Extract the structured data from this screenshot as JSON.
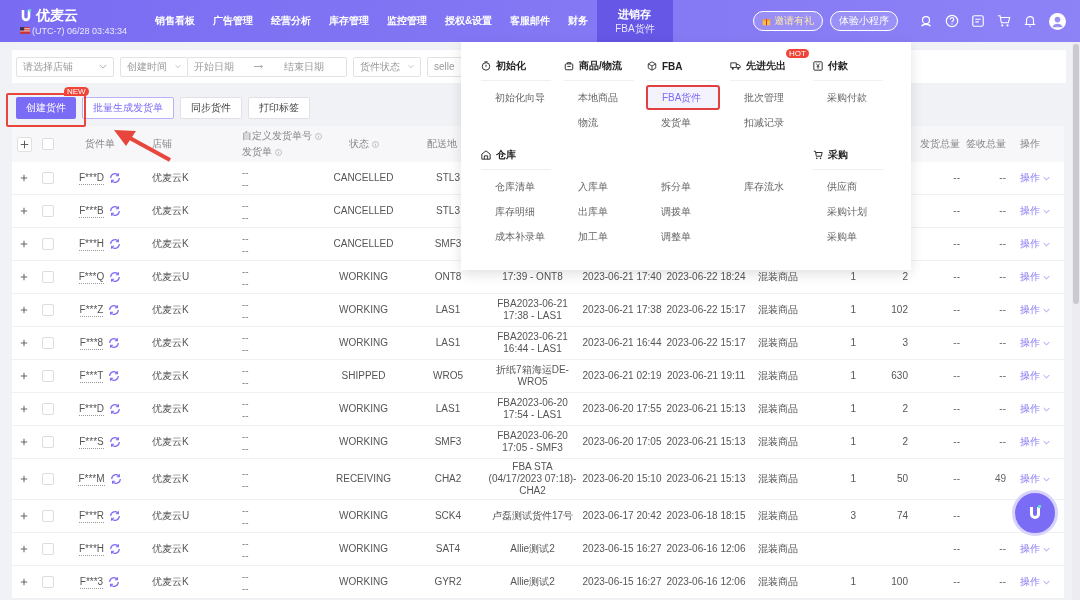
{
  "header": {
    "logo": "优麦云",
    "timezone": "(UTC-7) 06/28 03:43:34",
    "nav": [
      {
        "label": "销售看板",
        "selected": false
      },
      {
        "label": "广告管理",
        "selected": false
      },
      {
        "label": "经营分析",
        "selected": false
      },
      {
        "label": "库存管理",
        "selected": false
      },
      {
        "label": "监控管理",
        "selected": false
      },
      {
        "label": "授权&设置",
        "selected": false
      },
      {
        "label": "客服邮件",
        "selected": false
      },
      {
        "label": "财务",
        "selected": false
      },
      {
        "label": "进销存",
        "sub": "FBA货件",
        "selected": true
      }
    ],
    "actions": [
      "邀请有礼",
      "体验小程序"
    ]
  },
  "filters": [
    {
      "kind": "select",
      "placeholder": "请选择店铺"
    },
    {
      "kind": "select",
      "placeholder": "创建时间"
    },
    {
      "kind": "range",
      "placeholder": "开始日期",
      "placeholder_2": "结束日期"
    },
    {
      "kind": "select",
      "placeholder": "货件状态"
    },
    {
      "kind": "text",
      "placeholder": "selle"
    }
  ],
  "toolbar": [
    {
      "label": "创建货件",
      "kind": "primary",
      "badge": "NEW"
    },
    {
      "label": "批量生成发货单",
      "kind": "outline"
    },
    {
      "label": "同步货件",
      "kind": "plain"
    },
    {
      "label": "打印标签",
      "kind": "plain"
    }
  ],
  "table": {
    "all_checked": false,
    "columns": [
      {},
      {},
      {
        "labels": [
          {
            "text": "货件单",
            "info": false
          }
        ]
      },
      {
        "labels": [
          {
            "text": "店铺",
            "info": false
          }
        ]
      },
      {
        "labels": [
          {
            "text": "自定义发货单号",
            "info": true
          },
          {
            "text": "发货单",
            "info": true
          }
        ]
      },
      {
        "labels": [
          {
            "text": "状态",
            "info": true
          }
        ]
      },
      {
        "labels": [
          {
            "text": "配送地",
            "info": false
          }
        ]
      },
      {},
      {},
      {},
      {},
      {},
      {},
      {
        "labels": [
          {
            "text": "发货总量",
            "info": false
          }
        ]
      },
      {
        "labels": [
          {
            "text": "签收总量",
            "info": false
          }
        ]
      },
      {
        "labels": [
          {
            "text": "操作",
            "info": false
          }
        ]
      }
    ],
    "rows": [
      {
        "checked": false,
        "shipment": "F***D",
        "shop": "优麦云K",
        "custom": [
          "--",
          "--"
        ],
        "status": "CANCELLED",
        "address": "STL3",
        "shipped": "--",
        "received": "--",
        "action": "操作"
      },
      {
        "checked": false,
        "shipment": "F***B",
        "shop": "优麦云K",
        "custom": [
          "--",
          "--"
        ],
        "status": "CANCELLED",
        "address": "STL3",
        "shipped": "--",
        "received": "--",
        "action": "操作"
      },
      {
        "checked": false,
        "shipment": "F***H",
        "shop": "优麦云K",
        "custom": [
          "--",
          "--"
        ],
        "status": "CANCELLED",
        "address": "SMF3",
        "shipped": "--",
        "received": "--",
        "action": "操作"
      },
      {
        "checked": false,
        "shipment": "F***Q",
        "shop": "优麦云U",
        "custom": [
          "--",
          "--"
        ],
        "status": "WORKING",
        "address": "ONT8",
        "name": "17:39 - ONT8",
        "created": "2023-06-21 17:40",
        "updated": "2023-06-22 18:24",
        "mix": "混装商品",
        "col_a": "1",
        "col_b": "2",
        "shipped": "--",
        "received": "--",
        "action": "操作"
      },
      {
        "checked": false,
        "shipment": "F***Z",
        "shop": "优麦云K",
        "custom": [
          "--",
          "--"
        ],
        "status": "WORKING",
        "address": "LAS1",
        "name": "FBA2023-06-21 17:38 - LAS1",
        "created": "2023-06-21 17:38",
        "updated": "2023-06-22 15:17",
        "mix": "混装商品",
        "col_a": "1",
        "col_b": "102",
        "shipped": "--",
        "received": "--",
        "action": "操作"
      },
      {
        "checked": false,
        "shipment": "F***8",
        "shop": "优麦云K",
        "custom": [
          "--",
          "--"
        ],
        "status": "WORKING",
        "address": "LAS1",
        "name": "FBA2023-06-21 16:44 - LAS1",
        "created": "2023-06-21 16:44",
        "updated": "2023-06-22 15:17",
        "mix": "混装商品",
        "col_a": "1",
        "col_b": "3",
        "shipped": "--",
        "received": "--",
        "action": "操作"
      },
      {
        "checked": false,
        "shipment": "F***T",
        "shop": "优麦云K",
        "custom": [
          "--",
          "--"
        ],
        "status": "SHIPPED",
        "address": "WRO5",
        "name": "折纸7箱海运DE-WRO5",
        "created": "2023-06-21 02:19",
        "updated": "2023-06-21 19:11",
        "mix": "混装商品",
        "col_a": "1",
        "col_b": "630",
        "shipped": "--",
        "received": "--",
        "action": "操作"
      },
      {
        "checked": false,
        "shipment": "F***D",
        "shop": "优麦云K",
        "custom": [
          "--",
          "--"
        ],
        "status": "WORKING",
        "address": "LAS1",
        "name": "FBA2023-06-20 17:54 - LAS1",
        "created": "2023-06-20 17:55",
        "updated": "2023-06-21 15:13",
        "mix": "混装商品",
        "col_a": "1",
        "col_b": "2",
        "shipped": "--",
        "received": "--",
        "action": "操作"
      },
      {
        "checked": false,
        "shipment": "F***S",
        "shop": "优麦云K",
        "custom": [
          "--",
          "--"
        ],
        "status": "WORKING",
        "address": "SMF3",
        "name": "FBA2023-06-20 17:05 - SMF3",
        "created": "2023-06-20 17:05",
        "updated": "2023-06-21 15:13",
        "mix": "混装商品",
        "col_a": "1",
        "col_b": "2",
        "shipped": "--",
        "received": "--",
        "action": "操作"
      },
      {
        "checked": false,
        "shipment": "F***M",
        "shop": "优麦云K",
        "custom": [
          "--",
          "--"
        ],
        "status": "RECEIVING",
        "address": "CHA2",
        "name": "FBA STA (04/17/2023 07:18)-CHA2",
        "created": "2023-06-20 15:10",
        "updated": "2023-06-21 15:13",
        "mix": "混装商品",
        "col_a": "1",
        "col_b": "50",
        "shipped": "--",
        "received": "49",
        "action": "操作"
      },
      {
        "checked": false,
        "shipment": "F***R",
        "shop": "优麦云U",
        "custom": [
          "--",
          "--"
        ],
        "status": "WORKING",
        "address": "SCK4",
        "name": "卢磊测试货件17号",
        "created": "2023-06-17 20:42",
        "updated": "2023-06-18 18:15",
        "mix": "混装商品",
        "col_a": "3",
        "col_b": "74",
        "shipped": "--"
      },
      {
        "checked": false,
        "shipment": "F***H",
        "shop": "优麦云K",
        "custom": [
          "--",
          "--"
        ],
        "status": "WORKING",
        "address": "SAT4",
        "name": "Allie测试2",
        "created": "2023-06-15 16:27",
        "updated": "2023-06-16 12:06",
        "mix": "混装商品",
        "shipped": "--",
        "received": "--",
        "action": "操作"
      },
      {
        "checked": false,
        "shipment": "F***3",
        "shop": "优麦云K",
        "custom": [
          "--",
          "--"
        ],
        "status": "WORKING",
        "address": "GYR2",
        "name": "Allie测试2",
        "created": "2023-06-15 16:27",
        "updated": "2023-06-16 12:06",
        "mix": "混装商品",
        "col_a": "1",
        "col_b": "100",
        "shipped": "--",
        "received": "--",
        "action": "操作"
      }
    ]
  },
  "menu": {
    "groups": [
      {
        "columns": [
          {
            "heading": {
              "label": "初始化"
            },
            "items": [
              {
                "label": "初始化向导",
                "selected": false
              }
            ]
          },
          {
            "heading": {
              "label": "商品/物流"
            },
            "items": [
              {
                "label": "本地商品",
                "selected": false
              },
              {
                "label": "物流",
                "selected": false
              }
            ]
          },
          {
            "heading": {
              "label": "FBA"
            },
            "items": [
              {
                "label": "FBA货件",
                "selected": true
              },
              {
                "label": "发货单",
                "selected": false
              }
            ]
          },
          {
            "heading": {
              "label": "先进先出",
              "badge": "HOT"
            },
            "items": [
              {
                "label": "批次管理",
                "selected": false
              },
              {
                "label": "扣减记录",
                "selected": false
              }
            ]
          },
          {
            "heading": {
              "label": "付款"
            },
            "items": [
              {
                "label": "采购付款",
                "selected": false
              }
            ]
          }
        ]
      },
      {
        "columns": [
          {
            "heading": {
              "label": "仓库"
            },
            "items": [
              {
                "label": "仓库清单",
                "selected": false
              },
              {
                "label": "库存明细",
                "selected": false
              },
              {
                "label": "成本补录单",
                "selected": false
              }
            ]
          },
          {
            "items": [
              {
                "label": "入库单",
                "selected": false
              },
              {
                "label": "出库单",
                "selected": false
              },
              {
                "label": "加工单",
                "selected": false
              }
            ]
          },
          {
            "items": [
              {
                "label": "拆分单",
                "selected": false
              },
              {
                "label": "调拨单",
                "selected": false
              },
              {
                "label": "调整单",
                "selected": false
              }
            ]
          },
          {
            "items": [
              {
                "label": "库存流水",
                "selected": false
              }
            ]
          },
          {
            "heading": {
              "label": "采购"
            },
            "items": [
              {
                "label": "供应商",
                "selected": false
              },
              {
                "label": "采购计划",
                "selected": false
              },
              {
                "label": "采购单",
                "selected": false
              }
            ]
          }
        ]
      }
    ]
  }
}
